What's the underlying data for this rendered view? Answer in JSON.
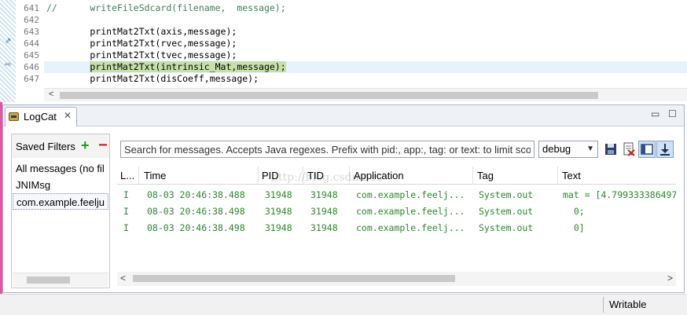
{
  "editor": {
    "lines": [
      {
        "number": "641",
        "text": "//      writeFileSdcard(filename,  message);",
        "kind": "comment"
      },
      {
        "number": "642",
        "text": "",
        "kind": "code"
      },
      {
        "number": "643",
        "text": "        printMat2Txt(axis,message);",
        "kind": "code"
      },
      {
        "number": "644",
        "text": "        printMat2Txt(rvec,message);",
        "kind": "code"
      },
      {
        "number": "645",
        "text": "        printMat2Txt(tvec,message);",
        "kind": "code"
      },
      {
        "number": "646",
        "text": "        printMat2Txt(intrinsic_Mat,message);",
        "kind": "current"
      },
      {
        "number": "647",
        "text": "        printMat2Txt(disCoeff,message);",
        "kind": "code"
      }
    ],
    "current_line_prefix": "        ",
    "current_line_highlight": "printMat2Txt(intrinsic_Mat,message);"
  },
  "logcat": {
    "tab_label": "LogCat",
    "tab_close": "✕",
    "minimize": "▭",
    "maximize": "☐",
    "saved_filters": {
      "title": "Saved Filters",
      "add_icon": "+",
      "remove_icon": "−",
      "items": [
        "All messages (no fil",
        "JNIMsg",
        "com.example.feelju"
      ],
      "selected_index": 2
    },
    "search": {
      "placeholder": "Search for messages. Accepts Java regexes. Prefix with pid:, app:, tag: or text: to limit scope."
    },
    "level": {
      "selected": "debug",
      "caret": "▼"
    },
    "columns": [
      "L...",
      "Time",
      "PID",
      "TID",
      "Application",
      "Tag",
      "Text"
    ],
    "rows": [
      {
        "level": "I",
        "time": "08-03 20:46:38.488",
        "pid": "31948",
        "tid": "31948",
        "application": "com.example.feelj...",
        "tag": "System.out",
        "text": "mat = [4.799333386497"
      },
      {
        "level": "I",
        "time": "08-03 20:46:38.498",
        "pid": "31948",
        "tid": "31948",
        "application": "com.example.feelj...",
        "tag": "System.out",
        "text": "  0;"
      },
      {
        "level": "I",
        "time": "08-03 20:46:38.498",
        "pid": "31948",
        "tid": "31948",
        "application": "com.example.feelj...",
        "tag": "System.out",
        "text": "  0]"
      }
    ],
    "watermark": "http://blog.csdn.net/",
    "log_text_color": "#2b8a2b"
  },
  "statusbar": {
    "mode": "Writable"
  }
}
